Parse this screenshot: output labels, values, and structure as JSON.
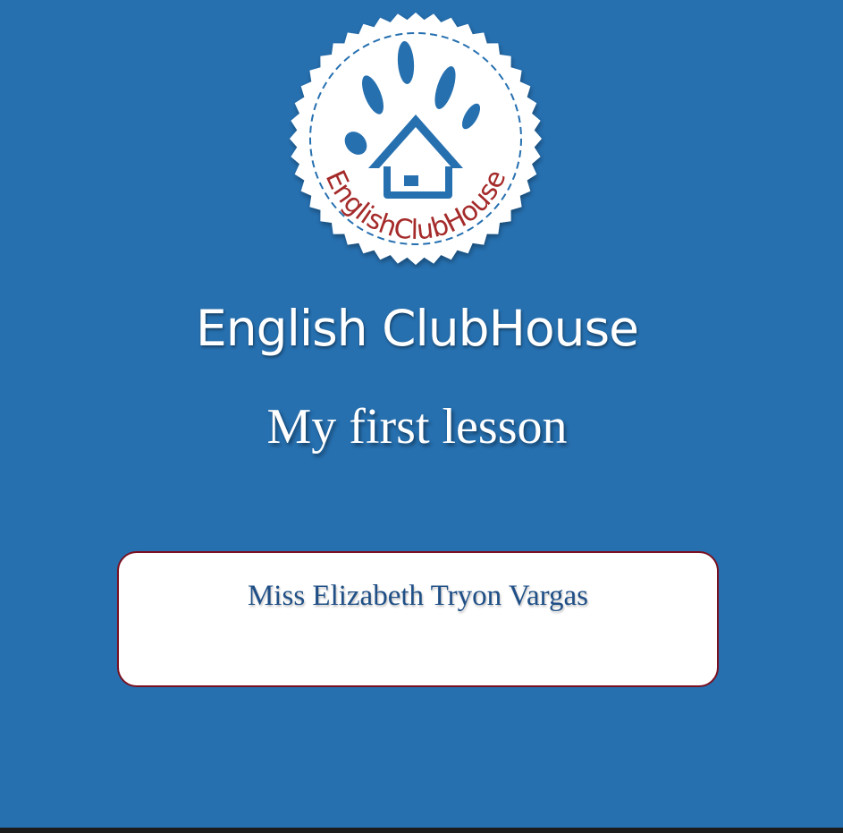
{
  "colors": {
    "background": "#2670b0",
    "logo_blue": "#2670b0",
    "logo_red": "#a52a2a",
    "card_border": "#7a1020",
    "teacher_text": "#1f4f86"
  },
  "logo": {
    "icon": "handprint-house-badge-icon",
    "wordmark": "EnglishClubHouse"
  },
  "header": {
    "site_title": "English ClubHouse",
    "lesson_title": "My first lesson"
  },
  "teacher_card": {
    "name": "Miss Elizabeth Tryon Vargas"
  }
}
